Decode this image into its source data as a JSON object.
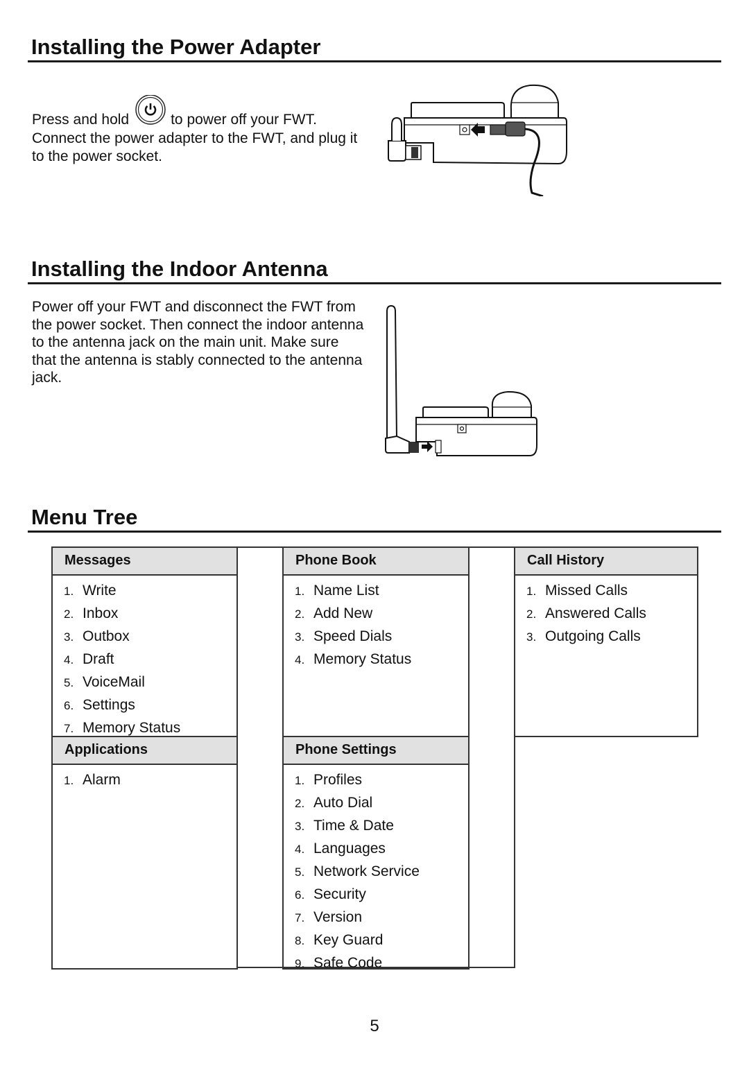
{
  "sections": {
    "power_adapter": {
      "title": "Installing the Power Adapter",
      "text_before_icon": "Press and hold",
      "text_after_icon": "to power off your FWT.",
      "text_rest": "Connect the power adapter to the FWT, and plug it to the power socket.",
      "icon": "power-button-icon"
    },
    "indoor_antenna": {
      "title": "Installing the Indoor Antenna",
      "text": "Power off your FWT and disconnect the FWT from the power socket. Then connect the indoor antenna to the antenna jack on the main unit. Make sure that the antenna is stably connected to the antenna jack."
    },
    "menu_tree": {
      "title": "Menu Tree",
      "menus": [
        {
          "title": "Messages",
          "items": [
            {
              "num": "1.",
              "label": "Write"
            },
            {
              "num": "2.",
              "label": "Inbox"
            },
            {
              "num": "3.",
              "label": "Outbox"
            },
            {
              "num": "4.",
              "label": "Draft"
            },
            {
              "num": "5.",
              "label": "VoiceMail"
            },
            {
              "num": "6.",
              "label": "Settings"
            },
            {
              "num": "7.",
              "label": "Memory Status"
            }
          ]
        },
        {
          "title": "Phone Book",
          "items": [
            {
              "num": "1.",
              "label": "Name List"
            },
            {
              "num": "2.",
              "label": "Add New"
            },
            {
              "num": "3.",
              "label": "Speed Dials"
            },
            {
              "num": "4.",
              "label": "Memory Status"
            }
          ]
        },
        {
          "title": "Call History",
          "items": [
            {
              "num": "1.",
              "label": "Missed Calls"
            },
            {
              "num": "2.",
              "label": "Answered Calls"
            },
            {
              "num": "3.",
              "label": "Outgoing Calls"
            }
          ]
        },
        {
          "title": "Applications",
          "items": [
            {
              "num": "1.",
              "label": "Alarm"
            }
          ]
        },
        {
          "title": "Phone Settings",
          "items": [
            {
              "num": "1.",
              "label": "Profiles"
            },
            {
              "num": "2.",
              "label": "Auto Dial"
            },
            {
              "num": "3.",
              "label": "Time & Date"
            },
            {
              "num": "4.",
              "label": "Languages"
            },
            {
              "num": "5.",
              "label": "Network Service"
            },
            {
              "num": "6.",
              "label": "Security"
            },
            {
              "num": "7.",
              "label": "Version"
            },
            {
              "num": "8.",
              "label": "Key Guard"
            },
            {
              "num": "9.",
              "label": "Safe Code"
            }
          ]
        }
      ]
    }
  },
  "page_number": "5",
  "colors": {
    "header_fill": "#e1e1e1",
    "border": "#333333",
    "text": "#111111"
  }
}
